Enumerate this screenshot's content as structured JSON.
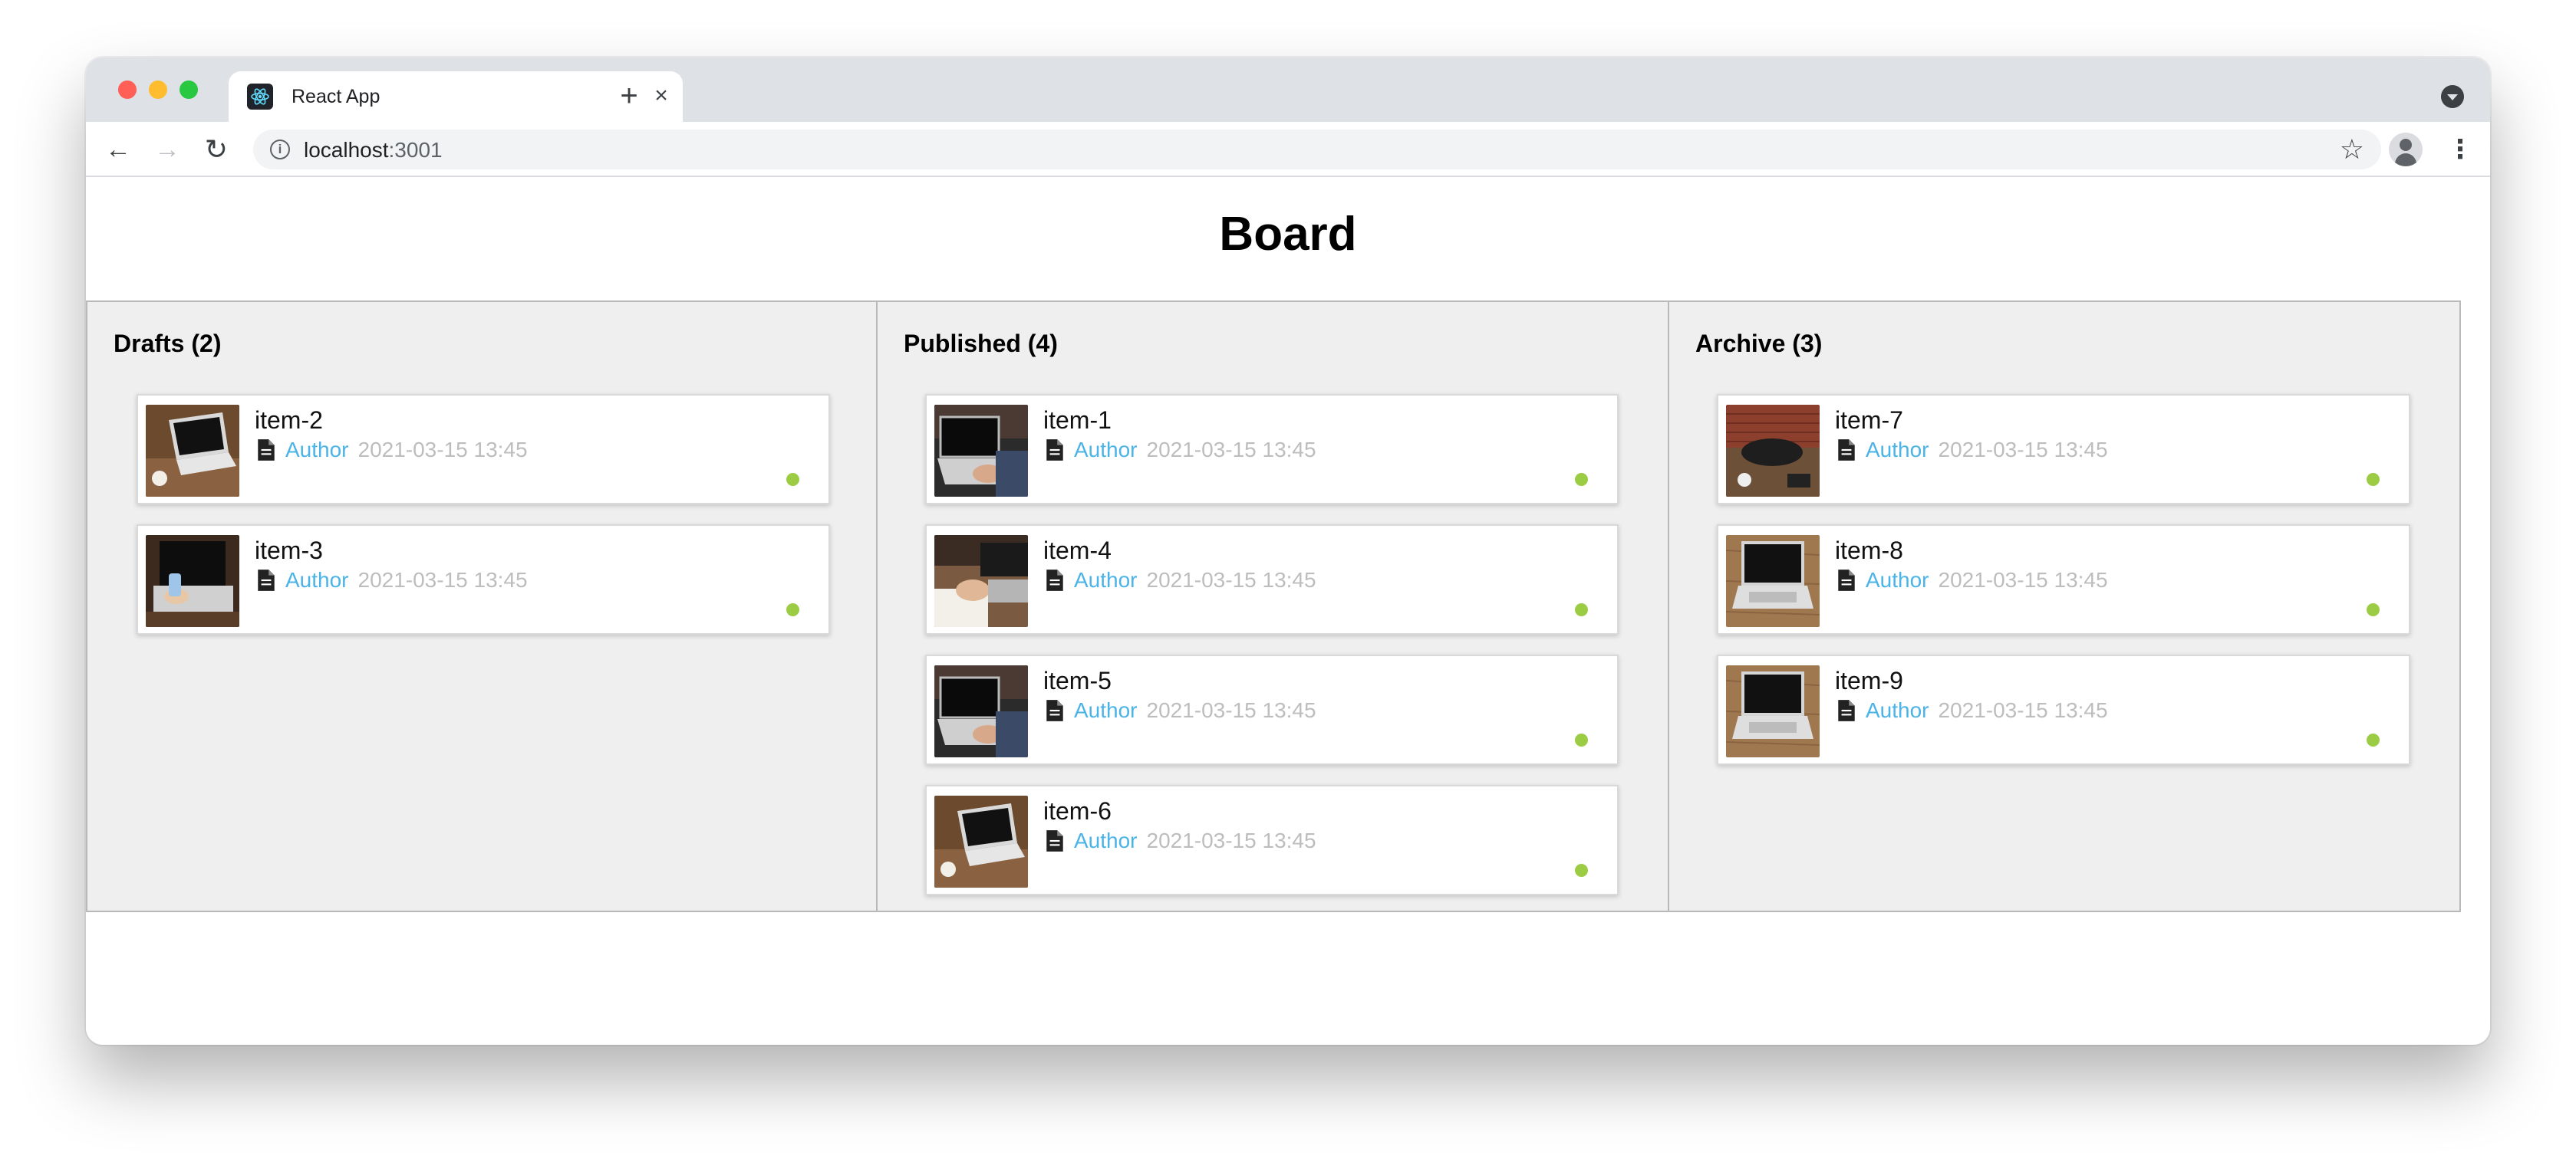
{
  "browser": {
    "tab_title": "React App",
    "url_host": "localhost",
    "url_port": ":3001"
  },
  "page": {
    "title": "Board"
  },
  "columns": [
    {
      "title": "Drafts (2)",
      "cards": [
        {
          "title": "item-2",
          "author": "Author",
          "date": "2021-03-15 13:45",
          "thumb": "laptop-desk"
        },
        {
          "title": "item-3",
          "author": "Author",
          "date": "2021-03-15 13:45",
          "thumb": "laptop-hands"
        }
      ]
    },
    {
      "title": "Published (4)",
      "cards": [
        {
          "title": "item-1",
          "author": "Author",
          "date": "2021-03-15 13:45",
          "thumb": "laptop-typing"
        },
        {
          "title": "item-4",
          "author": "Author",
          "date": "2021-03-15 13:45",
          "thumb": "laptop-writing"
        },
        {
          "title": "item-5",
          "author": "Author",
          "date": "2021-03-15 13:45",
          "thumb": "laptop-typing"
        },
        {
          "title": "item-6",
          "author": "Author",
          "date": "2021-03-15 13:45",
          "thumb": "laptop-desk"
        }
      ]
    },
    {
      "title": "Archive (3)",
      "cards": [
        {
          "title": "item-7",
          "author": "Author",
          "date": "2021-03-15 13:45",
          "thumb": "desk-brick"
        },
        {
          "title": "item-8",
          "author": "Author",
          "date": "2021-03-15 13:45",
          "thumb": "laptop-wood"
        },
        {
          "title": "item-9",
          "author": "Author",
          "date": "2021-03-15 13:45",
          "thumb": "laptop-wood"
        }
      ]
    }
  ],
  "colors": {
    "author_link": "#4ab3e8",
    "status_dot": "#9ccc44",
    "column_bg": "#efefef",
    "date_text": "#bdbdbd"
  },
  "icons": {
    "card_meta": "document-icon",
    "card_status": "status-dot-icon"
  }
}
